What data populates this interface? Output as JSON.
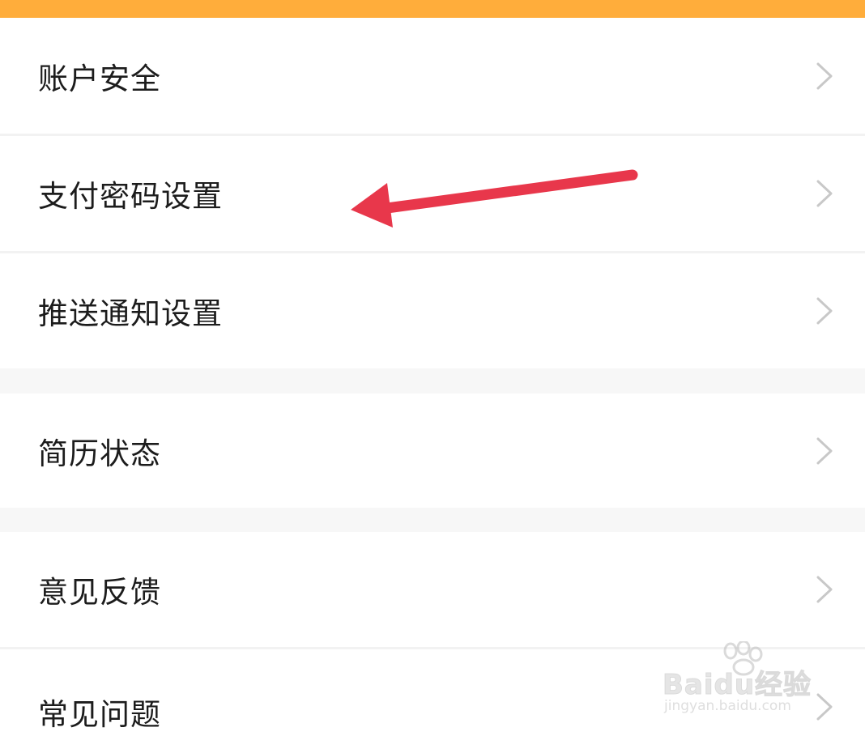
{
  "menu": {
    "items": [
      {
        "label": "账户安全"
      },
      {
        "label": "支付密码设置"
      },
      {
        "label": "推送通知设置"
      },
      {
        "label": "简历状态"
      },
      {
        "label": "意见反馈"
      },
      {
        "label": "常见问题"
      }
    ]
  },
  "colors": {
    "top_bar": "#ffad3b",
    "annotation_arrow": "#e8374b",
    "chevron": "#c8c8c8"
  },
  "watermark": {
    "logo_text": "Baidu经验",
    "url": "jingyan.baidu.com"
  }
}
